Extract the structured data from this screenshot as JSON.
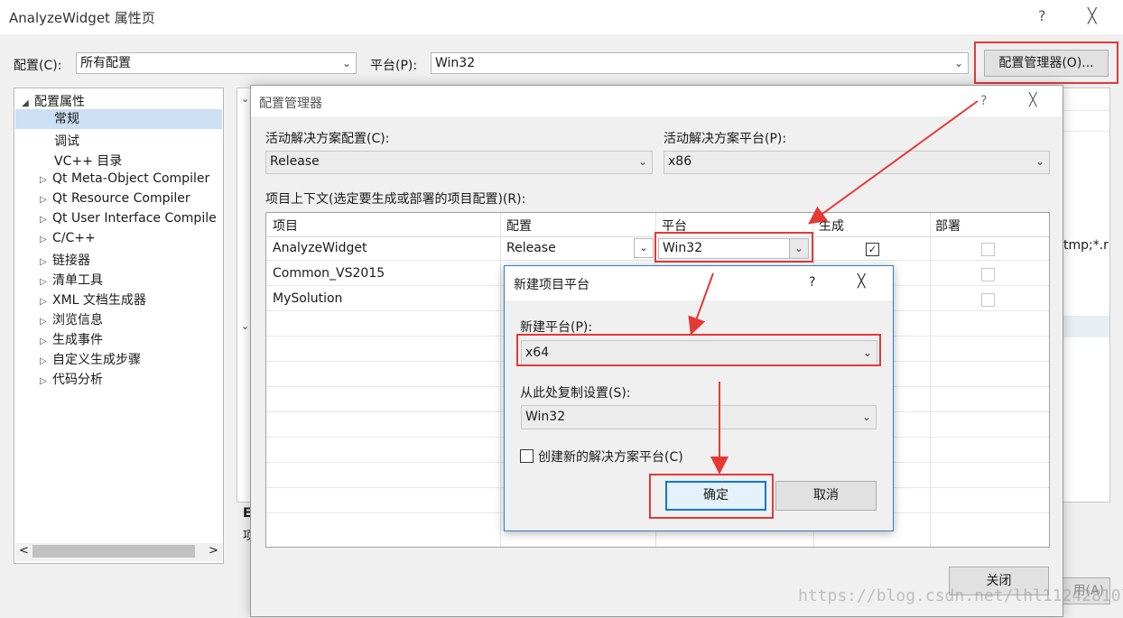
{
  "window": {
    "title": "AnalyzeWidget 属性页",
    "help": "?",
    "close": "╳"
  },
  "toolbar": {
    "config_label": "配置(C):",
    "config_value": "所有配置",
    "platform_label": "平台(P):",
    "platform_value": "Win32",
    "manager_button": "配置管理器(O)..."
  },
  "tree": {
    "root": "配置属性",
    "items": [
      "常规",
      "调试",
      "VC++ 目录",
      "Qt Meta-Object Compiler",
      "Qt Resource Compiler",
      "Qt User Interface Compile",
      "C/C++",
      "链接器",
      "清单工具",
      "XML 文档生成器",
      "浏览信息",
      "生成事件",
      "自定义生成步骤",
      "代码分析"
    ],
    "scroll_left": "<",
    "scroll_right": ">"
  },
  "background": {
    "tmp_text": "tmp;*.r",
    "bottom_e": "E",
    "bottom_x": "项",
    "apply_partial": "用(A)"
  },
  "config_manager": {
    "title": "配置管理器",
    "help": "?",
    "close": "╳",
    "active_config_label": "活动解决方案配置(C):",
    "active_config_value": "Release",
    "active_platform_label": "活动解决方案平台(P):",
    "active_platform_value": "x86",
    "context_label": "项目上下文(选定要生成或部署的项目配置)(R):",
    "columns": [
      "项目",
      "配置",
      "平台",
      "生成",
      "部署"
    ],
    "rows": [
      {
        "project": "AnalyzeWidget",
        "config": "Release",
        "platform": "Win32",
        "build": true
      },
      {
        "project": "Common_VS2015"
      },
      {
        "project": "MySolution"
      }
    ],
    "close_button": "关闭"
  },
  "new_platform": {
    "title": "新建项目平台",
    "help": "?",
    "close": "╳",
    "platform_label": "新建平台(P):",
    "platform_value": "x64",
    "copy_label": "从此处复制设置(S):",
    "copy_value": "Win32",
    "create_solution_label": "创建新的解决方案平台(C)",
    "ok": "确定",
    "cancel": "取消"
  },
  "watermark": "https://blog.csdn.net/lhl1124281072",
  "colors": {
    "highlight": "#e53935",
    "accent": "#0078d7",
    "selection": "#cce0f5"
  }
}
